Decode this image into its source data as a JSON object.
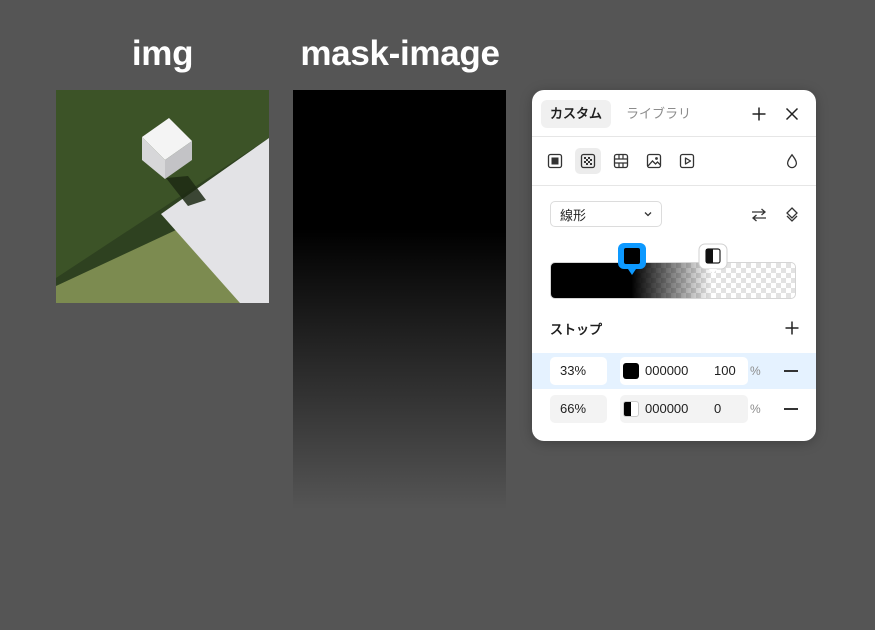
{
  "labels": {
    "img": "img",
    "mask_image": "mask-image"
  },
  "panel": {
    "tabs": [
      {
        "label": "カスタム",
        "active": true
      },
      {
        "label": "ライブラリ",
        "active": false
      }
    ],
    "header_icons": [
      "plus-icon",
      "close-icon"
    ],
    "fill_types": [
      "solid-fill-icon",
      "gradient-fill-icon",
      "pattern-fill-icon",
      "image-fill-icon",
      "video-fill-icon"
    ],
    "selected_fill_type": "gradient",
    "gradient_type": "線形",
    "gradient_actions": [
      "swap-icon",
      "rotate-icon"
    ],
    "stops_heading": "ストップ",
    "stops": [
      {
        "position": "33%",
        "hex": "000000",
        "opacity": "100",
        "opacity_unit": "%",
        "selected": true
      },
      {
        "position": "66%",
        "hex": "000000",
        "opacity": "0",
        "opacity_unit": "%",
        "selected": false
      }
    ]
  },
  "colors": {
    "background": "#555555",
    "accent": "#0d99ff",
    "selected_row": "#e5f2ff"
  }
}
